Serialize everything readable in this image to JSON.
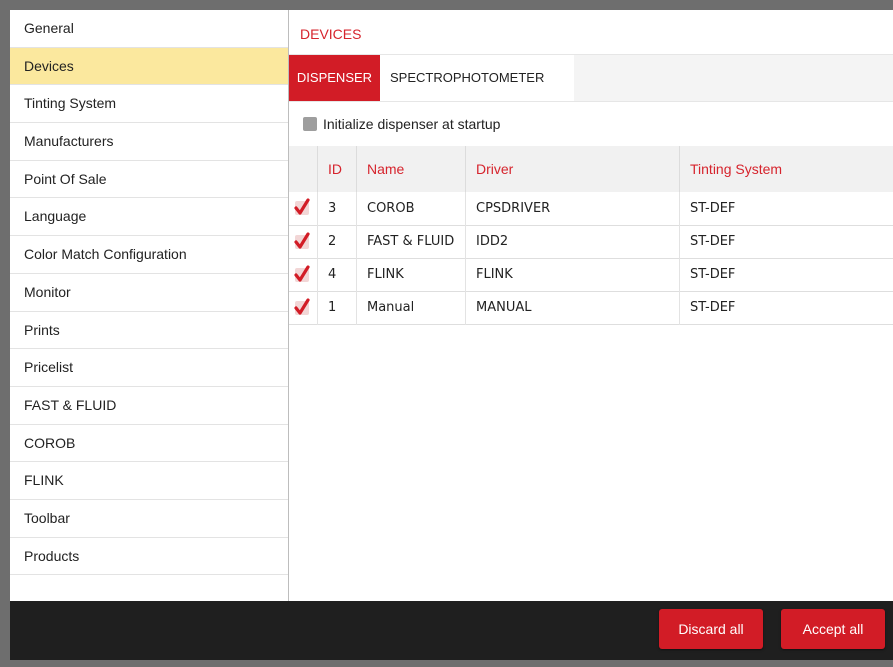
{
  "sidebar": {
    "items": [
      {
        "label": "General"
      },
      {
        "label": "Devices",
        "active": true
      },
      {
        "label": "Tinting System"
      },
      {
        "label": "Manufacturers"
      },
      {
        "label": "Point Of Sale"
      },
      {
        "label": "Language"
      },
      {
        "label": "Color Match Configuration"
      },
      {
        "label": "Monitor"
      },
      {
        "label": "Prints"
      },
      {
        "label": "Pricelist"
      },
      {
        "label": "FAST & FLUID"
      },
      {
        "label": "COROB"
      },
      {
        "label": "FLINK"
      },
      {
        "label": "Toolbar"
      },
      {
        "label": "Products"
      }
    ]
  },
  "main": {
    "title": "DEVICES",
    "tabs": [
      {
        "label": "DISPENSER",
        "active": true
      },
      {
        "label": "SPECTROPHOTOMETER",
        "active": false
      }
    ],
    "init_label": "Initialize dispenser at startup",
    "table": {
      "headers": [
        "ID",
        "Name",
        "Driver",
        "Tinting System"
      ],
      "rows": [
        {
          "checked": true,
          "id": "3",
          "name": "COROB",
          "driver": "CPSDRIVER",
          "tinting": "ST-DEF"
        },
        {
          "checked": true,
          "id": "2",
          "name": "FAST & FLUID",
          "driver": "IDD2",
          "tinting": "ST-DEF"
        },
        {
          "checked": true,
          "id": "4",
          "name": "FLINK",
          "driver": "FLINK",
          "tinting": "ST-DEF"
        },
        {
          "checked": true,
          "id": "1",
          "name": "Manual",
          "driver": "MANUAL",
          "tinting": "ST-DEF"
        }
      ]
    }
  },
  "footer": {
    "discard_label": "Discard all",
    "accept_label": "Accept all"
  },
  "colors": {
    "accent": "#d21c26",
    "active_sidebar": "#fbe89e",
    "footer": "#1f1f1f"
  }
}
